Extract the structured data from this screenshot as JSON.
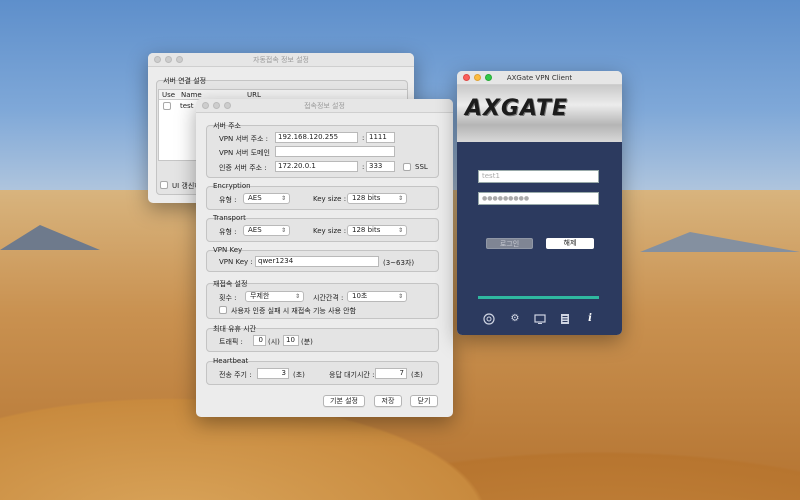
{
  "auto_window": {
    "title": "자동접속 정보 설정",
    "group_label": "서버 연결 설정",
    "columns": [
      "Use",
      "Name",
      "URL"
    ],
    "row": {
      "name": "test"
    },
    "update_label": "UI 갱신하"
  },
  "conn_window": {
    "title": "접속정보 설정",
    "server": {
      "legend": "서버 주소",
      "vpn_addr_label": "VPN 서버 주소 :",
      "vpn_addr": "192.168.120.255",
      "vpn_port": "1111",
      "vpn_domain_label": "VPN 서버 도메인",
      "vpn_domain": "",
      "auth_addr_label": "인증 서버 주소 :",
      "auth_addr": "172.20.0.1",
      "auth_port": "333",
      "ssl_label": "SSL",
      "colon": ":"
    },
    "encryption": {
      "legend": "Encryption",
      "type_label": "유형 :",
      "type_value": "AES",
      "key_label": "Key size :",
      "key_value": "128 bits"
    },
    "transport": {
      "legend": "Transport",
      "type_label": "유형 :",
      "type_value": "AES",
      "key_label": "Key size :",
      "key_value": "128 bits"
    },
    "vpnkey": {
      "legend": "VPN Key",
      "label": "VPN Key :",
      "value": "qwer1234",
      "hint": "(3~63자)"
    },
    "reconnect": {
      "legend": "재접속 설정",
      "count_label": "횟수 :",
      "count_value": "무제한",
      "interval_label": "시간간격 :",
      "interval_value": "10초",
      "fail_label": "사용자 인증 실패 시 재접속 기능 사용 안함"
    },
    "idle": {
      "legend": "최대 유휴 시간",
      "traffic_label": "트래픽 :",
      "hours": "0",
      "hours_unit": "(시)",
      "minutes": "10",
      "minutes_unit": "(분)"
    },
    "heartbeat": {
      "legend": "Heartbeat",
      "period_label": "전송 주기 :",
      "period": "3",
      "period_unit": "(초)",
      "wait_label": "응답 대기시간 :",
      "wait": "7",
      "wait_unit": "(초)"
    },
    "buttons": {
      "default": "기본 설정",
      "save": "저장",
      "close": "닫기"
    }
  },
  "vpn_client": {
    "title": "AXGate VPN Client",
    "logo": "AXGATE",
    "user_placeholder": "test1",
    "password_mask": "●●●●●●●●●",
    "login_label": "로그인",
    "release_label": "해제",
    "icons": [
      "power-icon",
      "gear-icon",
      "monitor-icon",
      "document-icon",
      "info-icon"
    ]
  }
}
